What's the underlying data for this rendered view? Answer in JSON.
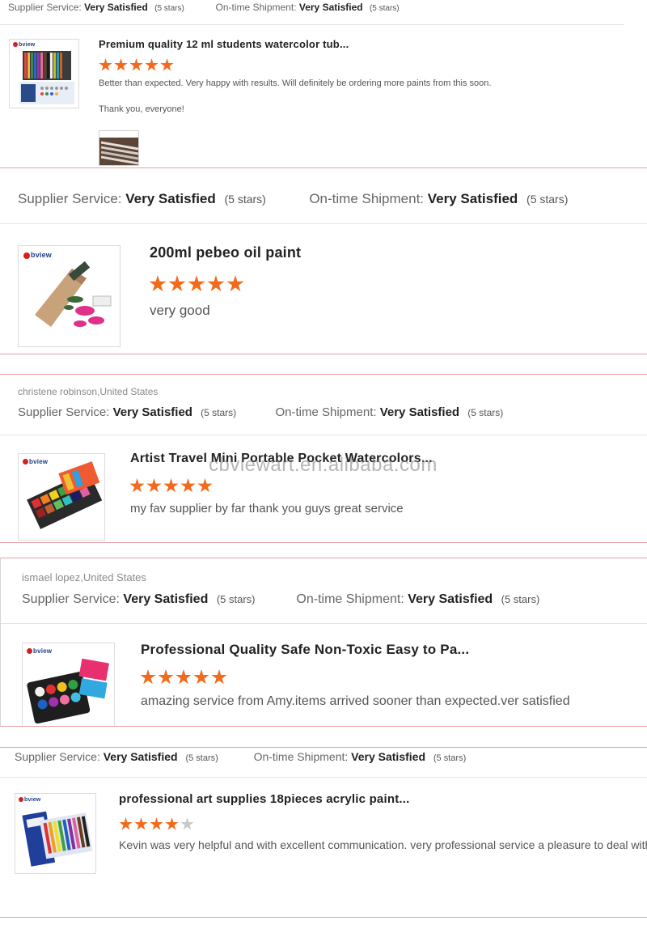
{
  "labels": {
    "supplier_service": "Supplier Service:",
    "ontime_shipment": "On-time Shipment:"
  },
  "colors": {
    "star_on": "#f26a1b",
    "star_off": "#c9c9c9",
    "frame": "#e3a0a8",
    "brand_text": "#1a3e8a",
    "brand_ring": "#d32020"
  },
  "reviews": [
    {
      "reviewer": "",
      "supplier_value": "Very Satisfied",
      "supplier_stars": "(5 stars)",
      "shipment_value": "Very Satisfied",
      "shipment_stars": "(5 stars)",
      "brand": "bview",
      "product_title": "Premium quality 12 ml students watercolor tub...",
      "rating": 5,
      "comment": "Better than expected. Very happy with results. Will definitely be ordering more paints from this soon.",
      "comment_extra": "Thank you, everyone!"
    },
    {
      "reviewer": "",
      "supplier_value": "Very Satisfied",
      "supplier_stars": "(5 stars)",
      "shipment_value": "Very Satisfied",
      "shipment_stars": "(5 stars)",
      "brand": "bview",
      "product_title": "200ml pebeo oil paint",
      "rating": 5,
      "comment": "very good"
    },
    {
      "reviewer": "christene robinson,United States",
      "supplier_value": "Very Satisfied",
      "supplier_stars": "(5 stars)",
      "shipment_value": "Very Satisfied",
      "shipment_stars": "(5 stars)",
      "brand": "bview",
      "product_title": "Artist Travel Mini Portable Pocket Watercolors...",
      "rating": 5,
      "comment": "my fav supplier by far thank you guys great service"
    },
    {
      "reviewer": "ismael lopez,United States",
      "supplier_value": "Very Satisfied",
      "supplier_stars": "(5 stars)",
      "shipment_value": "Very Satisfied",
      "shipment_stars": "(5 stars)",
      "brand": "bview",
      "product_title": "Professional Quality Safe Non-Toxic Easy to Pa...",
      "rating": 5,
      "comment": "amazing service from Amy.items arrived sooner than expected.ver satisfied"
    },
    {
      "reviewer": "",
      "supplier_value": "Very Satisfied",
      "supplier_stars": "(5 stars)",
      "shipment_value": "Very Satisfied",
      "shipment_stars": "(5 stars)",
      "brand": "bview",
      "product_title": "professional art supplies 18pieces acrylic paint...",
      "rating": 4,
      "comment": "Kevin was very helpful and with excellent communication. very professional service a pleasure to deal with"
    }
  ],
  "watermark": "cbviewart.en.alibaba.com"
}
